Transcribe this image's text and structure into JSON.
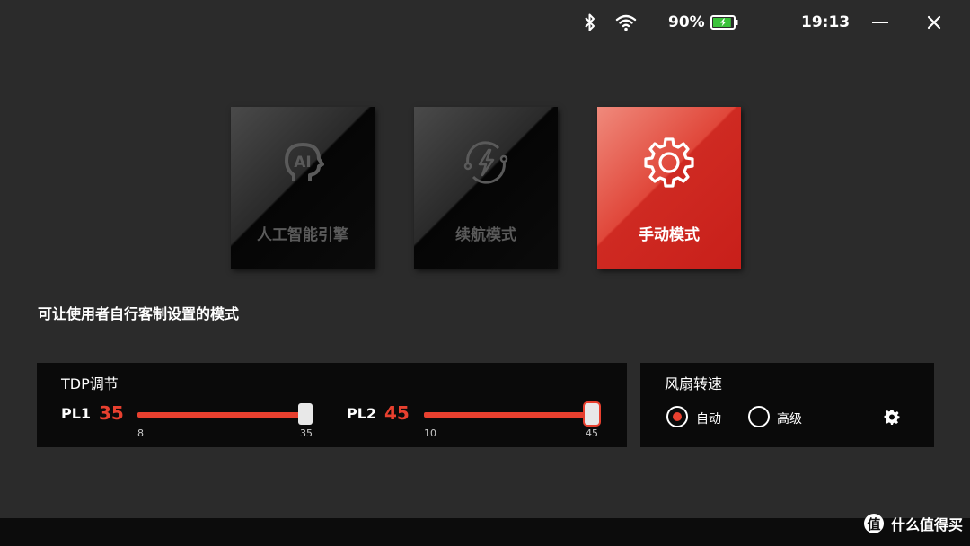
{
  "statusbar": {
    "battery_percent": "90%",
    "battery_level": 0.9,
    "time": "19:13",
    "icons": [
      "bluetooth-icon",
      "wifi-icon",
      "battery-icon",
      "minimize-icon",
      "close-icon"
    ]
  },
  "modes": [
    {
      "label": "人工智能引擎",
      "icon": "ai-head-icon",
      "active": false
    },
    {
      "label": "续航模式",
      "icon": "lightning-cycle-icon",
      "active": false
    },
    {
      "label": "手动模式",
      "icon": "gear-icon",
      "active": true
    }
  ],
  "description": "可让使用者自行客制设置的模式",
  "tdp": {
    "title": "TDP调节",
    "pl1": {
      "name": "PL1",
      "value": "35",
      "min": "8",
      "max": "35"
    },
    "pl2": {
      "name": "PL2",
      "value": "45",
      "min": "10",
      "max": "45"
    }
  },
  "fan": {
    "title": "风扇转速",
    "options": [
      {
        "label": "自动",
        "selected": true
      },
      {
        "label": "高级",
        "selected": false
      }
    ],
    "settings_icon": "gear-icon"
  },
  "watermark": {
    "logo": "值",
    "text": "什么值得买"
  },
  "colors": {
    "accent": "#e8402f",
    "panel": "#0a0a0a",
    "background": "#2b2b2b"
  }
}
